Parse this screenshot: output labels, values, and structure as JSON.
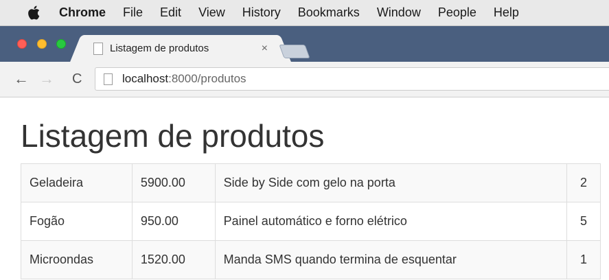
{
  "menubar": {
    "apple_icon": "apple-icon",
    "items": [
      "Chrome",
      "File",
      "Edit",
      "View",
      "History",
      "Bookmarks",
      "Window",
      "People",
      "Help"
    ]
  },
  "window": {
    "traffic_colors": {
      "close": "#ff5f57",
      "minimize": "#ffbd2e",
      "maximize": "#28c940"
    }
  },
  "tab": {
    "title": "Listagem de produtos",
    "close_glyph": "×"
  },
  "toolbar": {
    "back_glyph": "←",
    "forward_glyph": "→",
    "reload_glyph": "C",
    "url_host": "localhost",
    "url_rest": ":8000/produtos"
  },
  "page": {
    "title": "Listagem de produtos",
    "products": [
      {
        "name": "Geladeira",
        "price": "5900.00",
        "description": "Side by Side com gelo na porta",
        "quantity": "2"
      },
      {
        "name": "Fogão",
        "price": "950.00",
        "description": "Painel automático e forno elétrico",
        "quantity": "5"
      },
      {
        "name": "Microondas",
        "price": "1520.00",
        "description": "Manda SMS quando termina de esquentar",
        "quantity": "1"
      }
    ]
  }
}
